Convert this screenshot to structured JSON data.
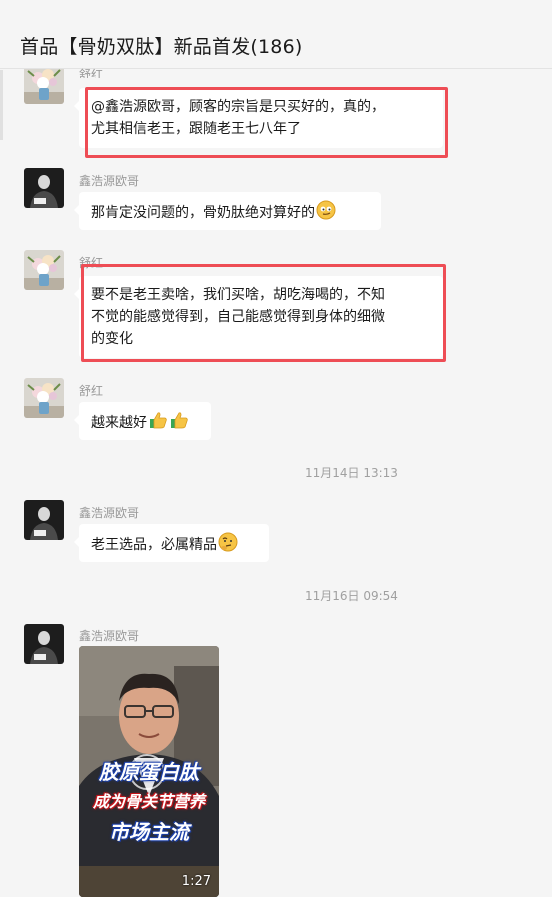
{
  "window": {
    "title": "首品【骨奶双肽】新品首发(186)"
  },
  "messages": [
    {
      "sender": "舒红",
      "avatar": "flower-vase-avatar",
      "lines": [
        "@鑫浩源欧哥，顾客的宗旨是只买好的，真的，",
        "尤其相信老王，跟随老王七八年了"
      ],
      "highlighted": true
    },
    {
      "sender": "鑫浩源欧哥",
      "avatar": "man-portrait-avatar",
      "lines": [
        "那肯定没问题的，骨奶肽绝对算好的"
      ],
      "emoji": "smirk-emoji"
    },
    {
      "sender": "舒红",
      "avatar": "flower-vase-avatar",
      "lines": [
        "要不是老王卖啥，我们买啥，胡吃海喝的，不知",
        "不觉的能感觉得到，自己能感觉得到身体的细微",
        "的变化"
      ],
      "highlighted": true
    },
    {
      "sender": "舒红",
      "avatar": "flower-vase-avatar",
      "lines": [
        "越来越好"
      ],
      "emoji": "thumbs-up-emoji x2"
    },
    {
      "timestamp": "11月14日 13:13"
    },
    {
      "sender": "鑫浩源欧哥",
      "avatar": "man-portrait-avatar",
      "lines": [
        "老王选品，必属精品"
      ],
      "emoji": "thinking-emoji"
    },
    {
      "timestamp": "11月16日 09:54"
    },
    {
      "sender": "鑫浩源欧哥",
      "avatar": "man-portrait-avatar",
      "video": {
        "captions": [
          "胶原蛋白肽",
          "成为骨关节营养",
          "市场主流"
        ],
        "duration": "1:27"
      }
    }
  ],
  "colors": {
    "background": "#f5f5f5",
    "bubble": "#ffffff",
    "highlight_border": "#ee4d55",
    "meta_text": "#999999"
  }
}
